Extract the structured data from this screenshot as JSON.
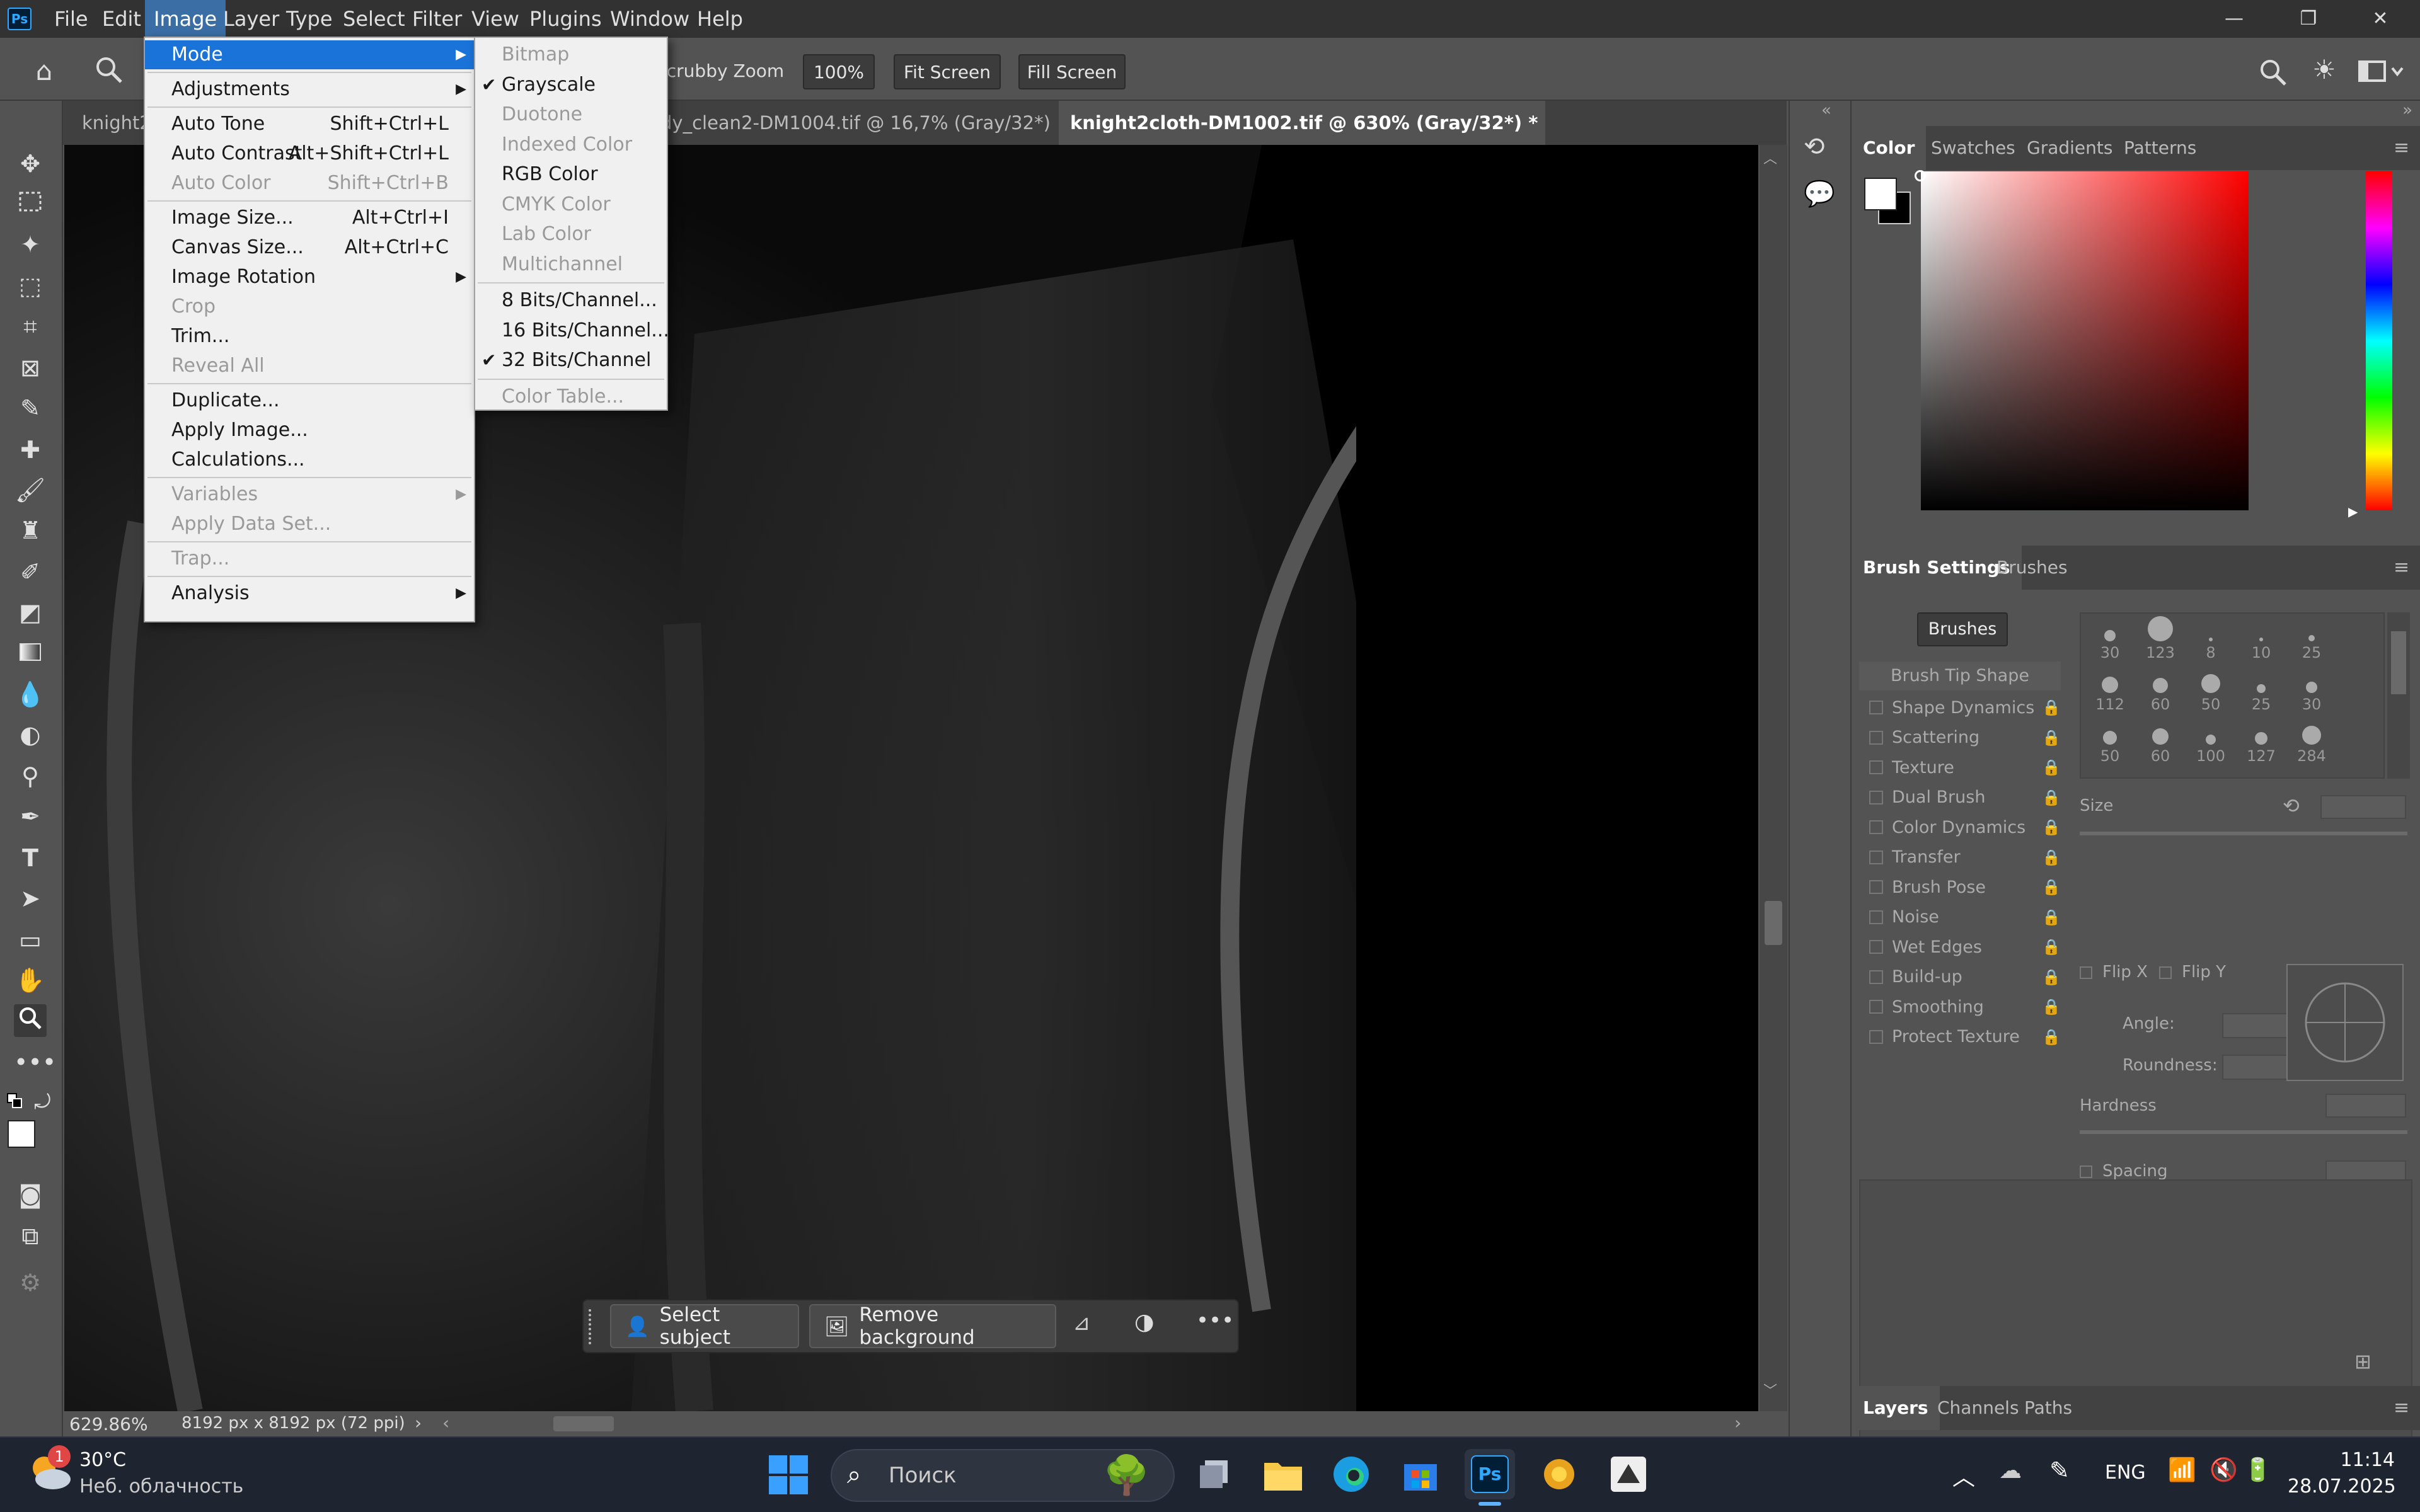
{
  "menubar": {
    "items": [
      "File",
      "Edit",
      "Image",
      "Layer",
      "Type",
      "Select",
      "Filter",
      "View",
      "Plugins",
      "Window",
      "Help"
    ],
    "active": "Image",
    "logo": "Ps"
  },
  "window_controls": {
    "minimize": "—",
    "restore": "❐",
    "close": "✕"
  },
  "options": {
    "scrubby_zoom": "Scrubby Zoom",
    "zoom_value": "100%",
    "fit_screen": "Fit Screen",
    "fill_screen": "Fill Screen"
  },
  "tabs": [
    {
      "label": "knight2"
    },
    {
      "label": "dy_clean2-DM1004.tif @ 16,7% (Gray/32*)"
    },
    {
      "label": "knight2cloth-DM1002.tif @ 630% (Gray/32*) *"
    }
  ],
  "image_menu": {
    "items": [
      {
        "label": "Mode",
        "shortcut": "",
        "submenu": true,
        "disabled": false,
        "highlight": true
      },
      {
        "sep": true
      },
      {
        "label": "Adjustments",
        "shortcut": "",
        "submenu": true,
        "disabled": false
      },
      {
        "sep": true
      },
      {
        "label": "Auto Tone",
        "shortcut": "Shift+Ctrl+L",
        "disabled": false
      },
      {
        "label": "Auto Contrast",
        "shortcut": "Alt+Shift+Ctrl+L",
        "disabled": false
      },
      {
        "label": "Auto Color",
        "shortcut": "Shift+Ctrl+B",
        "disabled": true
      },
      {
        "sep": true
      },
      {
        "label": "Image Size...",
        "shortcut": "Alt+Ctrl+I",
        "disabled": false
      },
      {
        "label": "Canvas Size...",
        "shortcut": "Alt+Ctrl+C",
        "disabled": false
      },
      {
        "label": "Image Rotation",
        "shortcut": "",
        "submenu": true,
        "disabled": false
      },
      {
        "label": "Crop",
        "shortcut": "",
        "disabled": true
      },
      {
        "label": "Trim...",
        "shortcut": "",
        "disabled": false
      },
      {
        "label": "Reveal All",
        "shortcut": "",
        "disabled": true
      },
      {
        "sep": true
      },
      {
        "label": "Duplicate...",
        "shortcut": "",
        "disabled": false
      },
      {
        "label": "Apply Image...",
        "shortcut": "",
        "disabled": false
      },
      {
        "label": "Calculations...",
        "shortcut": "",
        "disabled": false
      },
      {
        "sep": true
      },
      {
        "label": "Variables",
        "shortcut": "",
        "submenu": true,
        "disabled": true
      },
      {
        "label": "Apply Data Set...",
        "shortcut": "",
        "disabled": true
      },
      {
        "sep": true
      },
      {
        "label": "Trap...",
        "shortcut": "",
        "disabled": true
      },
      {
        "sep": true
      },
      {
        "label": "Analysis",
        "shortcut": "",
        "submenu": true,
        "disabled": false
      }
    ]
  },
  "mode_submenu": {
    "items": [
      {
        "label": "Bitmap",
        "disabled": true
      },
      {
        "label": "Grayscale",
        "checked": true,
        "disabled": false
      },
      {
        "label": "Duotone",
        "disabled": true
      },
      {
        "label": "Indexed Color",
        "disabled": true
      },
      {
        "label": "RGB Color",
        "disabled": false
      },
      {
        "label": "CMYK Color",
        "disabled": true
      },
      {
        "label": "Lab Color",
        "disabled": true
      },
      {
        "label": "Multichannel",
        "disabled": true
      },
      {
        "sep": true
      },
      {
        "label": "8 Bits/Channel...",
        "disabled": false
      },
      {
        "label": "16 Bits/Channel...",
        "disabled": false
      },
      {
        "label": "32 Bits/Channel",
        "checked": true,
        "disabled": false
      },
      {
        "sep": true
      },
      {
        "label": "Color Table...",
        "disabled": true
      }
    ]
  },
  "color_panel": {
    "tabs": [
      "Color",
      "Swatches",
      "Gradients",
      "Patterns"
    ],
    "active": "Color",
    "hue": "#ff0000"
  },
  "brush_panel": {
    "tabs": [
      "Brush Settings",
      "Brushes"
    ],
    "brushes_button": "Brushes",
    "tip_shape": "Brush Tip Shape",
    "options": [
      "Shape Dynamics",
      "Scattering",
      "Texture",
      "Dual Brush",
      "Color Dynamics",
      "Transfer",
      "Brush Pose",
      "Noise",
      "Wet Edges",
      "Build-up",
      "Smoothing",
      "Protect Texture"
    ],
    "brush_sizes": [
      "30",
      "123",
      "8",
      "10",
      "25",
      "112",
      "60",
      "50",
      "25",
      "30",
      "50",
      "60",
      "100",
      "127",
      "284"
    ],
    "size_label": "Size",
    "flip_x": "Flip X",
    "flip_y": "Flip Y",
    "angle_label": "Angle:",
    "roundness_label": "Roundness:",
    "hardness_label": "Hardness",
    "spacing_label": "Spacing"
  },
  "layers_panel": {
    "tabs": [
      "Layers",
      "Channels",
      "Paths"
    ],
    "active": "Layers"
  },
  "status": {
    "zoom": "629.86%",
    "doc_info": "8192 px x 8192 px (72 ppi)"
  },
  "contextual_bar": {
    "select_subject": "Select subject",
    "remove_background": "Remove background"
  },
  "taskbar": {
    "weather_temp": "30°C",
    "weather_desc": "Неб. облачность",
    "weather_badge": "1",
    "search_placeholder": "Поиск",
    "lang": "ENG",
    "time": "11:14",
    "date": "28.07.2025"
  }
}
